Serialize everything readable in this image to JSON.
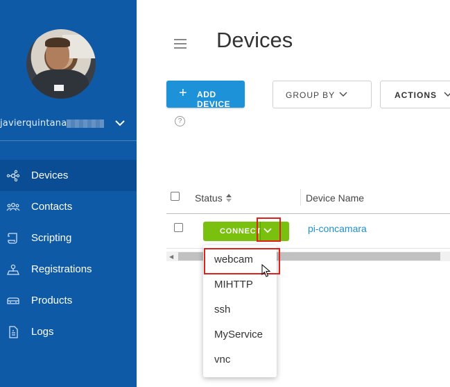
{
  "sidebar": {
    "username": "javierquintana",
    "items": [
      {
        "label": "Devices",
        "icon": "devices-icon",
        "active": true
      },
      {
        "label": "Contacts",
        "icon": "contacts-icon",
        "active": false
      },
      {
        "label": "Scripting",
        "icon": "scripting-icon",
        "active": false
      },
      {
        "label": "Registrations",
        "icon": "registrations-icon",
        "active": false
      },
      {
        "label": "Products",
        "icon": "products-icon",
        "active": false
      },
      {
        "label": "Logs",
        "icon": "logs-icon",
        "active": false
      }
    ]
  },
  "header": {
    "title": "Devices"
  },
  "toolbar": {
    "add_label": "ADD DEVICE",
    "group_label": "GROUP BY",
    "actions_label": "ACTIONS",
    "help": "?"
  },
  "table": {
    "columns": [
      "Status",
      "Device Name"
    ],
    "rows": [
      {
        "connect_label": "CONNECT",
        "device_name": "pi-concamara"
      }
    ]
  },
  "connect_menu": {
    "options": [
      "webcam",
      "MIHTTP",
      "ssh",
      "MyService",
      "vnc"
    ]
  },
  "colors": {
    "sidebar": "#0e5aa7",
    "primary": "#1d92d8",
    "connect": "#7ac10f",
    "highlight": "#e0201a",
    "link": "#1d8fd0"
  }
}
